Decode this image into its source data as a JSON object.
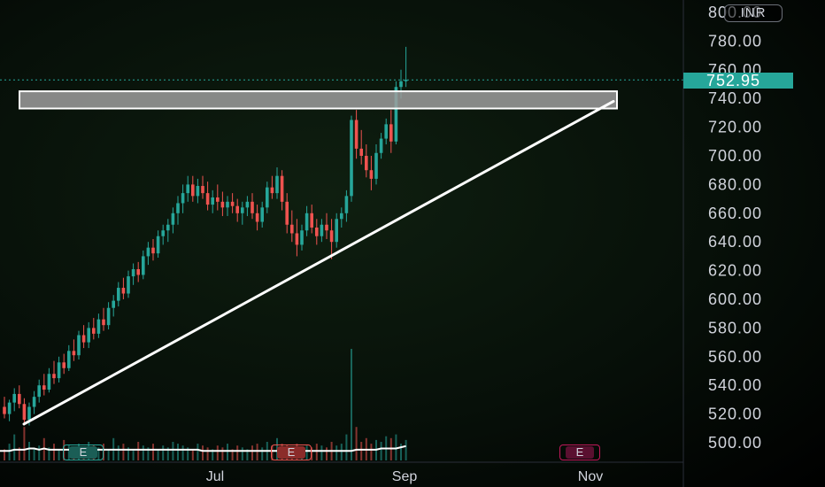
{
  "currency": "INR",
  "last_price": "752.95",
  "colors": {
    "up": "#26a69a",
    "down": "#ef5350",
    "last_price_bg": "#26a69a",
    "trendline": "#ffffff",
    "resistance_zone": "#9e9e9e",
    "earnings_past": "#26a69a",
    "earnings_down": "#ef5350",
    "earnings_future": "#c2185b"
  },
  "events": {
    "e1": {
      "label": "E",
      "kind": "earnings-up"
    },
    "e2": {
      "label": "E",
      "kind": "earnings-down"
    },
    "e3": {
      "label": "E",
      "kind": "earnings-future"
    }
  },
  "chart_data": {
    "type": "candlestick",
    "y_axis": {
      "ticks": [
        "800.00",
        "780.00",
        "760.00",
        "740.00",
        "720.00",
        "700.00",
        "680.00",
        "660.00",
        "640.00",
        "620.00",
        "600.00",
        "580.00",
        "560.00",
        "540.00",
        "520.00",
        "500.00"
      ],
      "range": [
        485,
        820
      ],
      "position": "right"
    },
    "x_axis": {
      "ticks": [
        "Jul",
        "Sep",
        "Nov"
      ]
    },
    "grid": false,
    "last_price": 752.95,
    "resistance_zone": {
      "low": 733,
      "high": 745
    },
    "trendline": {
      "from_price": 513,
      "to_price": 738
    },
    "ohlc": [
      [
        525,
        532,
        517,
        520
      ],
      [
        520,
        530,
        515,
        528
      ],
      [
        528,
        538,
        522,
        534
      ],
      [
        534,
        540,
        524,
        527
      ],
      [
        527,
        531,
        512,
        516
      ],
      [
        516,
        528,
        512,
        525
      ],
      [
        525,
        536,
        520,
        532
      ],
      [
        532,
        544,
        528,
        540
      ],
      [
        540,
        548,
        533,
        537
      ],
      [
        537,
        552,
        535,
        548
      ],
      [
        548,
        557,
        541,
        545
      ],
      [
        545,
        560,
        542,
        556
      ],
      [
        556,
        562,
        548,
        552
      ],
      [
        552,
        568,
        550,
        564
      ],
      [
        564,
        572,
        557,
        561
      ],
      [
        561,
        578,
        558,
        575
      ],
      [
        575,
        582,
        566,
        570
      ],
      [
        570,
        584,
        566,
        580
      ],
      [
        580,
        587,
        572,
        576
      ],
      [
        576,
        590,
        573,
        586
      ],
      [
        586,
        594,
        578,
        582
      ],
      [
        582,
        598,
        579,
        594
      ],
      [
        594,
        603,
        588,
        599
      ],
      [
        599,
        612,
        595,
        608
      ],
      [
        608,
        615,
        600,
        604
      ],
      [
        604,
        620,
        601,
        616
      ],
      [
        616,
        625,
        610,
        621
      ],
      [
        621,
        626,
        612,
        617
      ],
      [
        617,
        634,
        614,
        630
      ],
      [
        630,
        640,
        624,
        636
      ],
      [
        636,
        642,
        627,
        632
      ],
      [
        632,
        648,
        629,
        644
      ],
      [
        644,
        652,
        638,
        648
      ],
      [
        648,
        656,
        640,
        652
      ],
      [
        652,
        664,
        646,
        660
      ],
      [
        660,
        672,
        652,
        667
      ],
      [
        667,
        680,
        660,
        674
      ],
      [
        674,
        686,
        668,
        680
      ],
      [
        680,
        686,
        668,
        672
      ],
      [
        672,
        684,
        667,
        679
      ],
      [
        679,
        686,
        670,
        674
      ],
      [
        674,
        682,
        662,
        666
      ],
      [
        666,
        676,
        660,
        671
      ],
      [
        671,
        680,
        662,
        668
      ],
      [
        668,
        675,
        658,
        664
      ],
      [
        664,
        672,
        658,
        668
      ],
      [
        668,
        674,
        660,
        665
      ],
      [
        665,
        670,
        654,
        660
      ],
      [
        660,
        668,
        652,
        664
      ],
      [
        664,
        672,
        658,
        668
      ],
      [
        668,
        674,
        656,
        660
      ],
      [
        660,
        666,
        648,
        654
      ],
      [
        654,
        668,
        650,
        664
      ],
      [
        664,
        682,
        660,
        678
      ],
      [
        678,
        686,
        670,
        674
      ],
      [
        674,
        692,
        670,
        686
      ],
      [
        686,
        690,
        662,
        668
      ],
      [
        668,
        674,
        646,
        652
      ],
      [
        652,
        662,
        640,
        646
      ],
      [
        646,
        656,
        630,
        638
      ],
      [
        638,
        652,
        634,
        648
      ],
      [
        648,
        665,
        644,
        660
      ],
      [
        660,
        666,
        646,
        650
      ],
      [
        650,
        656,
        638,
        644
      ],
      [
        644,
        656,
        640,
        652
      ],
      [
        652,
        660,
        642,
        648
      ],
      [
        648,
        656,
        628,
        640
      ],
      [
        640,
        660,
        636,
        656
      ],
      [
        656,
        664,
        650,
        660
      ],
      [
        660,
        676,
        654,
        672
      ],
      [
        672,
        728,
        668,
        725
      ],
      [
        725,
        732,
        698,
        705
      ],
      [
        705,
        718,
        694,
        700
      ],
      [
        700,
        708,
        685,
        690
      ],
      [
        690,
        700,
        676,
        684
      ],
      [
        684,
        708,
        680,
        702
      ],
      [
        702,
        716,
        698,
        712
      ],
      [
        712,
        726,
        708,
        722
      ],
      [
        722,
        732,
        702,
        710
      ],
      [
        710,
        752,
        708,
        748
      ],
      [
        748,
        760,
        740,
        752
      ],
      [
        752,
        776,
        748,
        753
      ]
    ],
    "volume": [
      6,
      9,
      14,
      7,
      18,
      10,
      6,
      8,
      12,
      7,
      9,
      6,
      11,
      8,
      7,
      9,
      6,
      10,
      8,
      7,
      9,
      6,
      12,
      8,
      9,
      7,
      6,
      10,
      8,
      7,
      9,
      6,
      8,
      7,
      10,
      9,
      8,
      7,
      6,
      9,
      8,
      7,
      6,
      8,
      7,
      9,
      6,
      8,
      7,
      6,
      8,
      9,
      7,
      10,
      8,
      12,
      9,
      8,
      7,
      9,
      6,
      8,
      7,
      9,
      8,
      7,
      10,
      8,
      9,
      14,
      60,
      18,
      10,
      12,
      9,
      11,
      10,
      13,
      12,
      14,
      9,
      11
    ],
    "volume_ma": [
      8,
      8,
      9,
      9,
      9,
      10,
      10,
      9,
      10,
      9,
      9,
      9,
      9,
      9,
      9,
      9,
      9,
      9,
      9,
      9,
      9,
      9,
      9,
      9,
      9,
      9,
      9,
      9,
      9,
      9,
      9,
      9,
      9,
      9,
      9,
      9,
      9,
      9,
      9,
      9,
      8,
      8,
      8,
      8,
      8,
      8,
      8,
      8,
      8,
      8,
      8,
      8,
      8,
      8,
      8,
      8,
      8,
      8,
      8,
      8,
      8,
      8,
      8,
      8,
      8,
      8,
      8,
      8,
      8,
      8,
      8,
      9,
      9,
      9,
      9,
      9,
      10,
      10,
      10,
      10,
      11,
      12
    ]
  }
}
